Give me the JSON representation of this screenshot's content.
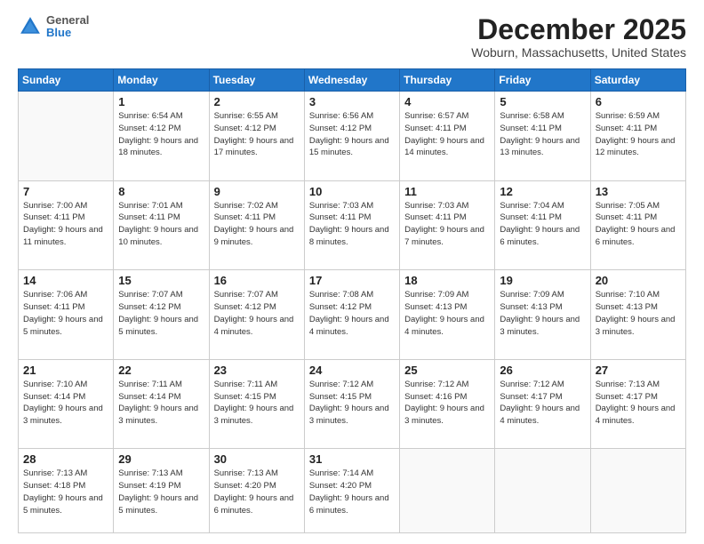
{
  "header": {
    "logo": {
      "general": "General",
      "blue": "Blue"
    },
    "title": "December 2025",
    "location": "Woburn, Massachusetts, United States"
  },
  "calendar": {
    "days_of_week": [
      "Sunday",
      "Monday",
      "Tuesday",
      "Wednesday",
      "Thursday",
      "Friday",
      "Saturday"
    ],
    "weeks": [
      [
        {
          "day": "",
          "info": ""
        },
        {
          "day": "1",
          "info": "Sunrise: 6:54 AM\nSunset: 4:12 PM\nDaylight: 9 hours\nand 18 minutes."
        },
        {
          "day": "2",
          "info": "Sunrise: 6:55 AM\nSunset: 4:12 PM\nDaylight: 9 hours\nand 17 minutes."
        },
        {
          "day": "3",
          "info": "Sunrise: 6:56 AM\nSunset: 4:12 PM\nDaylight: 9 hours\nand 15 minutes."
        },
        {
          "day": "4",
          "info": "Sunrise: 6:57 AM\nSunset: 4:11 PM\nDaylight: 9 hours\nand 14 minutes."
        },
        {
          "day": "5",
          "info": "Sunrise: 6:58 AM\nSunset: 4:11 PM\nDaylight: 9 hours\nand 13 minutes."
        },
        {
          "day": "6",
          "info": "Sunrise: 6:59 AM\nSunset: 4:11 PM\nDaylight: 9 hours\nand 12 minutes."
        }
      ],
      [
        {
          "day": "7",
          "info": "Sunrise: 7:00 AM\nSunset: 4:11 PM\nDaylight: 9 hours\nand 11 minutes."
        },
        {
          "day": "8",
          "info": "Sunrise: 7:01 AM\nSunset: 4:11 PM\nDaylight: 9 hours\nand 10 minutes."
        },
        {
          "day": "9",
          "info": "Sunrise: 7:02 AM\nSunset: 4:11 PM\nDaylight: 9 hours\nand 9 minutes."
        },
        {
          "day": "10",
          "info": "Sunrise: 7:03 AM\nSunset: 4:11 PM\nDaylight: 9 hours\nand 8 minutes."
        },
        {
          "day": "11",
          "info": "Sunrise: 7:03 AM\nSunset: 4:11 PM\nDaylight: 9 hours\nand 7 minutes."
        },
        {
          "day": "12",
          "info": "Sunrise: 7:04 AM\nSunset: 4:11 PM\nDaylight: 9 hours\nand 6 minutes."
        },
        {
          "day": "13",
          "info": "Sunrise: 7:05 AM\nSunset: 4:11 PM\nDaylight: 9 hours\nand 6 minutes."
        }
      ],
      [
        {
          "day": "14",
          "info": "Sunrise: 7:06 AM\nSunset: 4:11 PM\nDaylight: 9 hours\nand 5 minutes."
        },
        {
          "day": "15",
          "info": "Sunrise: 7:07 AM\nSunset: 4:12 PM\nDaylight: 9 hours\nand 5 minutes."
        },
        {
          "day": "16",
          "info": "Sunrise: 7:07 AM\nSunset: 4:12 PM\nDaylight: 9 hours\nand 4 minutes."
        },
        {
          "day": "17",
          "info": "Sunrise: 7:08 AM\nSunset: 4:12 PM\nDaylight: 9 hours\nand 4 minutes."
        },
        {
          "day": "18",
          "info": "Sunrise: 7:09 AM\nSunset: 4:13 PM\nDaylight: 9 hours\nand 4 minutes."
        },
        {
          "day": "19",
          "info": "Sunrise: 7:09 AM\nSunset: 4:13 PM\nDaylight: 9 hours\nand 3 minutes."
        },
        {
          "day": "20",
          "info": "Sunrise: 7:10 AM\nSunset: 4:13 PM\nDaylight: 9 hours\nand 3 minutes."
        }
      ],
      [
        {
          "day": "21",
          "info": "Sunrise: 7:10 AM\nSunset: 4:14 PM\nDaylight: 9 hours\nand 3 minutes."
        },
        {
          "day": "22",
          "info": "Sunrise: 7:11 AM\nSunset: 4:14 PM\nDaylight: 9 hours\nand 3 minutes."
        },
        {
          "day": "23",
          "info": "Sunrise: 7:11 AM\nSunset: 4:15 PM\nDaylight: 9 hours\nand 3 minutes."
        },
        {
          "day": "24",
          "info": "Sunrise: 7:12 AM\nSunset: 4:15 PM\nDaylight: 9 hours\nand 3 minutes."
        },
        {
          "day": "25",
          "info": "Sunrise: 7:12 AM\nSunset: 4:16 PM\nDaylight: 9 hours\nand 3 minutes."
        },
        {
          "day": "26",
          "info": "Sunrise: 7:12 AM\nSunset: 4:17 PM\nDaylight: 9 hours\nand 4 minutes."
        },
        {
          "day": "27",
          "info": "Sunrise: 7:13 AM\nSunset: 4:17 PM\nDaylight: 9 hours\nand 4 minutes."
        }
      ],
      [
        {
          "day": "28",
          "info": "Sunrise: 7:13 AM\nSunset: 4:18 PM\nDaylight: 9 hours\nand 5 minutes."
        },
        {
          "day": "29",
          "info": "Sunrise: 7:13 AM\nSunset: 4:19 PM\nDaylight: 9 hours\nand 5 minutes."
        },
        {
          "day": "30",
          "info": "Sunrise: 7:13 AM\nSunset: 4:20 PM\nDaylight: 9 hours\nand 6 minutes."
        },
        {
          "day": "31",
          "info": "Sunrise: 7:14 AM\nSunset: 4:20 PM\nDaylight: 9 hours\nand 6 minutes."
        },
        {
          "day": "",
          "info": ""
        },
        {
          "day": "",
          "info": ""
        },
        {
          "day": "",
          "info": ""
        }
      ]
    ]
  }
}
